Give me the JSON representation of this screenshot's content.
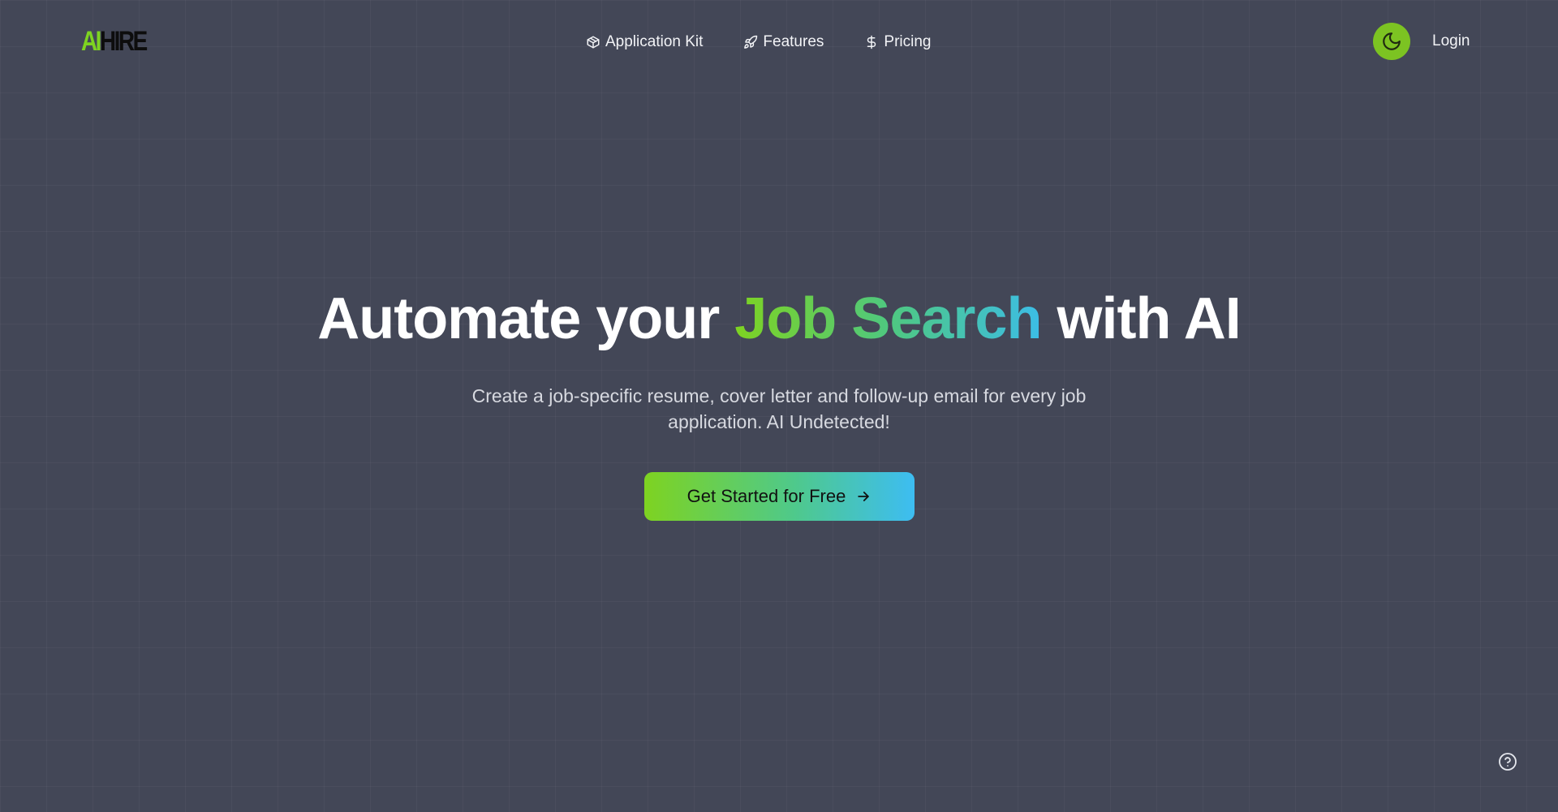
{
  "header": {
    "logo": {
      "part1": "AI",
      "part2": "HIRE"
    },
    "nav": [
      {
        "label": "Application Kit",
        "icon": "package-icon"
      },
      {
        "label": "Features",
        "icon": "rocket-icon"
      },
      {
        "label": "Pricing",
        "icon": "dollar-icon"
      }
    ],
    "theme_toggle_icon": "moon-icon",
    "login_label": "Login"
  },
  "hero": {
    "title_before": "Automate your ",
    "title_accent": "Job Search",
    "title_after": " with AI",
    "subtitle_line1": "Create a job-specific resume, cover letter and follow-up email for every job",
    "subtitle_line2": "application. AI Undetected!",
    "cta_label": "Get Started for Free"
  },
  "colors": {
    "background": "#434757",
    "brand_green": "#7ed321",
    "brand_blue": "#3dbdf2",
    "toggle_green": "#7cc322"
  }
}
